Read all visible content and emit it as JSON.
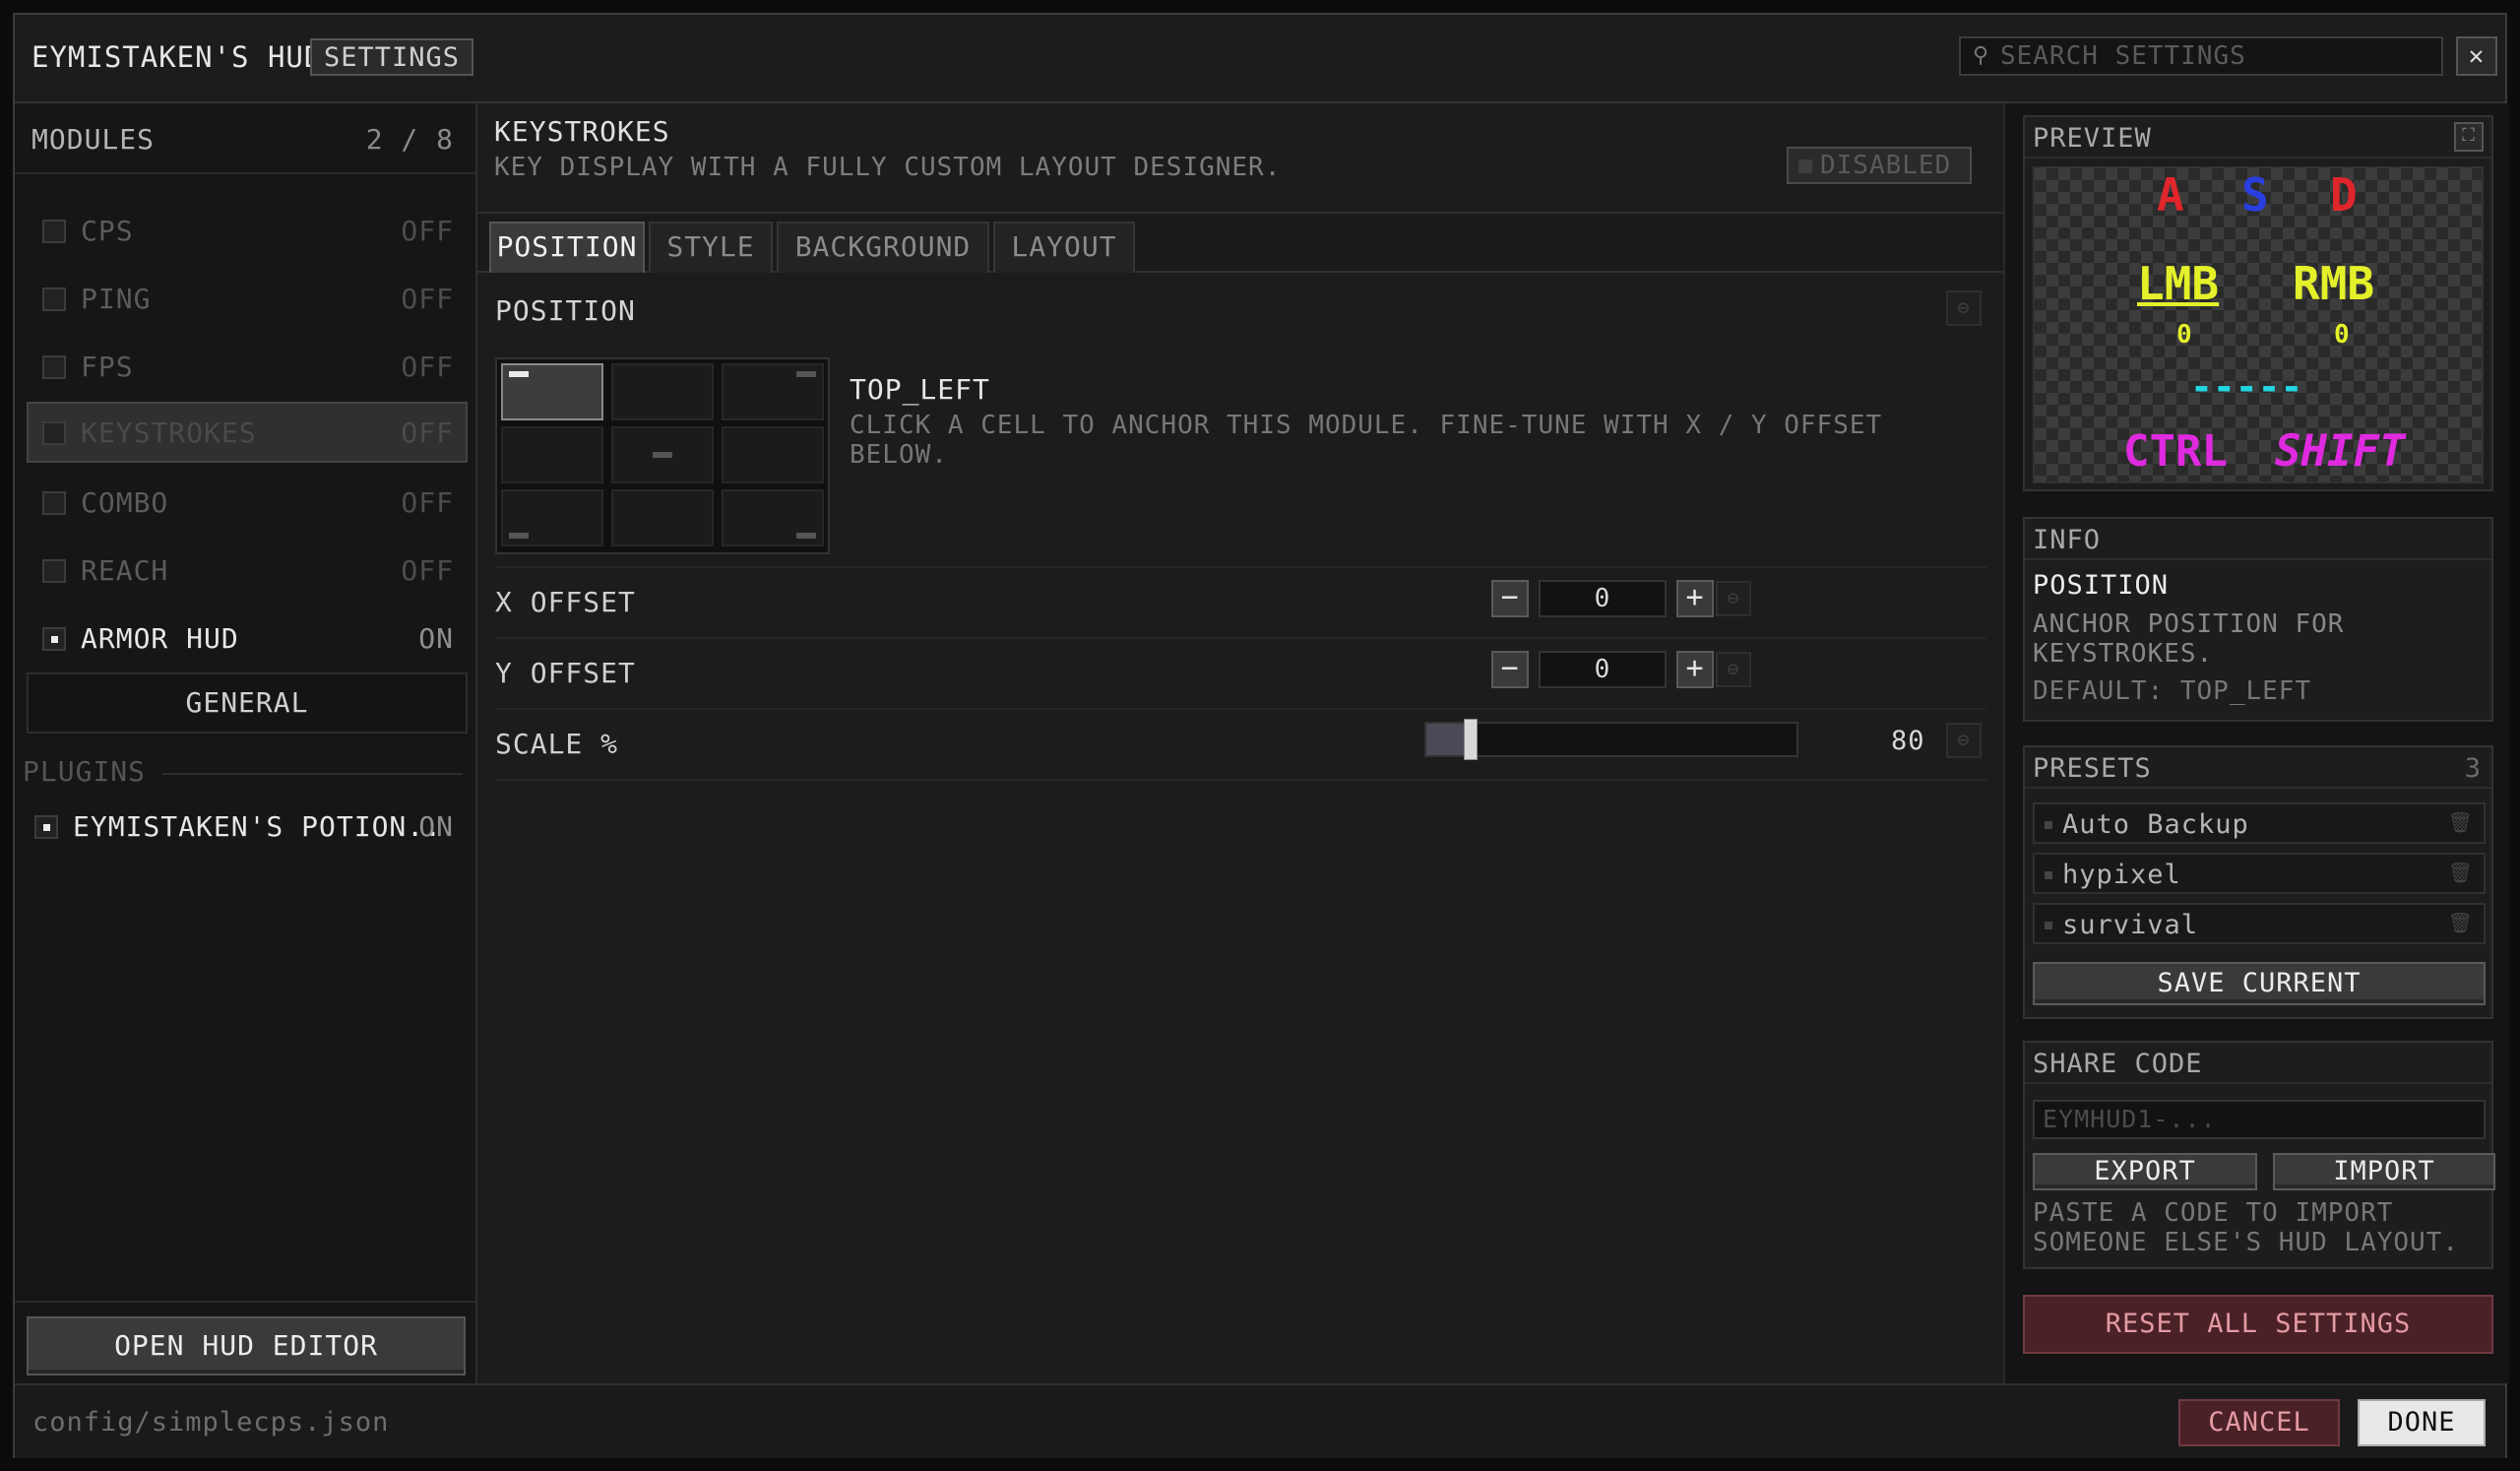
{
  "header": {
    "app_title": "EYMISTAKEN'S HUD",
    "badge": "SETTINGS",
    "search_placeholder": "SEARCH SETTINGS",
    "close_label": "✕"
  },
  "sidebar": {
    "modules_label": "MODULES",
    "modules_count": "2 / 8",
    "modules": [
      {
        "name": "CPS",
        "status": "OFF"
      },
      {
        "name": "PING",
        "status": "OFF"
      },
      {
        "name": "FPS",
        "status": "OFF"
      },
      {
        "name": "KEYSTROKES",
        "status": "OFF"
      },
      {
        "name": "COMBO",
        "status": "OFF"
      },
      {
        "name": "REACH",
        "status": "OFF"
      },
      {
        "name": "ARMOR HUD",
        "status": "ON"
      }
    ],
    "general_label": "GENERAL",
    "plugins_label": "PLUGINS",
    "plugins": [
      {
        "name": "EYMISTAKEN'S POTION..",
        "status": "ON"
      }
    ],
    "open_editor_label": "OPEN HUD EDITOR"
  },
  "main": {
    "module_title": "KEYSTROKES",
    "module_desc": "KEY DISPLAY WITH A FULLY CUSTOM LAYOUT DESIGNER.",
    "disabled_label": "DISABLED",
    "tabs": [
      "POSITION",
      "STYLE",
      "BACKGROUND",
      "LAYOUT"
    ],
    "active_tab": "POSITION",
    "section_title": "POSITION",
    "anchor_value": "TOP_LEFT",
    "anchor_help": "CLICK A CELL TO ANCHOR THIS MODULE. FINE-TUNE WITH X / Y OFFSET BELOW.",
    "x_offset_label": "X OFFSET",
    "x_offset_value": "0",
    "y_offset_label": "Y OFFSET",
    "y_offset_value": "0",
    "scale_label": "SCALE %",
    "scale_value": "80",
    "scale_fraction": 0.12,
    "minus_glyph": "−",
    "plus_glyph": "+",
    "reset_glyph": "⊖"
  },
  "preview": {
    "title": "PREVIEW",
    "keys": {
      "a": "A",
      "s": "S",
      "d": "D",
      "lmb": "LMB",
      "rmb": "RMB",
      "lmb_count": "0",
      "rmb_count": "0",
      "space": "-----",
      "ctrl": "CTRL",
      "shift": "SHIFT"
    },
    "colors": {
      "a": "#e0262b",
      "s": "#2a3fe0",
      "d": "#e0262b",
      "mouse": "#e4f02a",
      "space": "#21d6e0",
      "mods": "#e02ae0"
    }
  },
  "info": {
    "title": "INFO",
    "item_title": "POSITION",
    "item_desc": "ANCHOR POSITION FOR KEYSTROKES.",
    "item_default": "DEFAULT: TOP_LEFT"
  },
  "presets": {
    "title": "PRESETS",
    "count": "3",
    "items": [
      "Auto Backup",
      "hypixel",
      "survival"
    ],
    "save_label": "SAVE CURRENT"
  },
  "share": {
    "title": "SHARE CODE",
    "placeholder": "EYMHUD1-...",
    "export_label": "EXPORT",
    "import_label": "IMPORT",
    "help": "PASTE A CODE TO IMPORT SOMEONE ELSE'S HUD LAYOUT."
  },
  "reset_all_label": "RESET ALL SETTINGS",
  "footer": {
    "config_path": "config/simplecps.json",
    "cancel_label": "CANCEL",
    "done_label": "DONE"
  }
}
